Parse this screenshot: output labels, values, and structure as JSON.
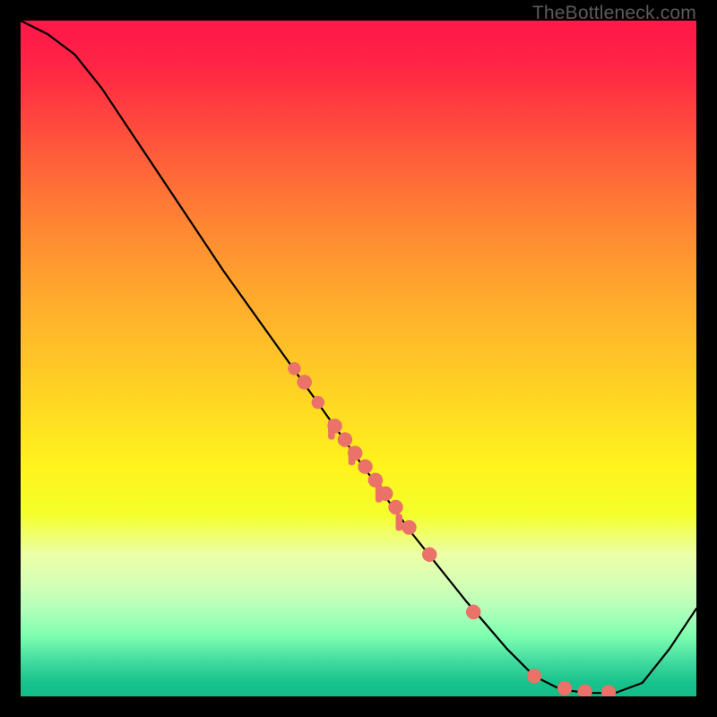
{
  "watermark": "TheBottleneck.com",
  "chart_data": {
    "type": "line",
    "title": "",
    "xlabel": "",
    "ylabel": "",
    "xlim": [
      0,
      100
    ],
    "ylim": [
      0,
      100
    ],
    "annotations": [
      "TheBottleneck.com"
    ],
    "curve": [
      {
        "x": 0,
        "y": 100
      },
      {
        "x": 4,
        "y": 98
      },
      {
        "x": 8,
        "y": 95
      },
      {
        "x": 12,
        "y": 90
      },
      {
        "x": 16,
        "y": 84
      },
      {
        "x": 22,
        "y": 75
      },
      {
        "x": 30,
        "y": 63
      },
      {
        "x": 40,
        "y": 49
      },
      {
        "x": 50,
        "y": 35
      },
      {
        "x": 58,
        "y": 24
      },
      {
        "x": 66,
        "y": 14
      },
      {
        "x": 72,
        "y": 7
      },
      {
        "x": 76,
        "y": 3
      },
      {
        "x": 80,
        "y": 1
      },
      {
        "x": 84,
        "y": 0.5
      },
      {
        "x": 88,
        "y": 0.5
      },
      {
        "x": 92,
        "y": 2
      },
      {
        "x": 96,
        "y": 7
      },
      {
        "x": 100,
        "y": 13
      }
    ],
    "scatter": [
      {
        "x": 40.5,
        "y": 48.5,
        "r": 7
      },
      {
        "x": 42.0,
        "y": 46.5,
        "r": 8
      },
      {
        "x": 44.0,
        "y": 43.5,
        "r": 7
      },
      {
        "x": 46.5,
        "y": 40.0,
        "r": 8
      },
      {
        "x": 48.0,
        "y": 38.0,
        "r": 8
      },
      {
        "x": 49.5,
        "y": 36.0,
        "r": 8
      },
      {
        "x": 51.0,
        "y": 34.0,
        "r": 8
      },
      {
        "x": 52.5,
        "y": 32.0,
        "r": 8
      },
      {
        "x": 54.0,
        "y": 30.0,
        "r": 8
      },
      {
        "x": 55.5,
        "y": 28.0,
        "r": 8
      },
      {
        "x": 57.5,
        "y": 25.0,
        "r": 8
      },
      {
        "x": 60.5,
        "y": 21.0,
        "r": 8
      },
      {
        "x": 67.0,
        "y": 12.5,
        "r": 8
      },
      {
        "x": 76.0,
        "y": 3.0,
        "r": 8
      },
      {
        "x": 80.5,
        "y": 1.2,
        "r": 8
      },
      {
        "x": 83.5,
        "y": 0.7,
        "r": 8
      },
      {
        "x": 87.0,
        "y": 0.6,
        "r": 8
      }
    ],
    "smudges": [
      {
        "x": 46.0,
        "y": 41.0,
        "w": 1.0,
        "h": 3.0
      },
      {
        "x": 49.0,
        "y": 37.0,
        "w": 1.0,
        "h": 2.8
      },
      {
        "x": 53.0,
        "y": 31.5,
        "w": 1.0,
        "h": 2.8
      },
      {
        "x": 56.0,
        "y": 27.0,
        "w": 1.0,
        "h": 2.5
      }
    ]
  }
}
